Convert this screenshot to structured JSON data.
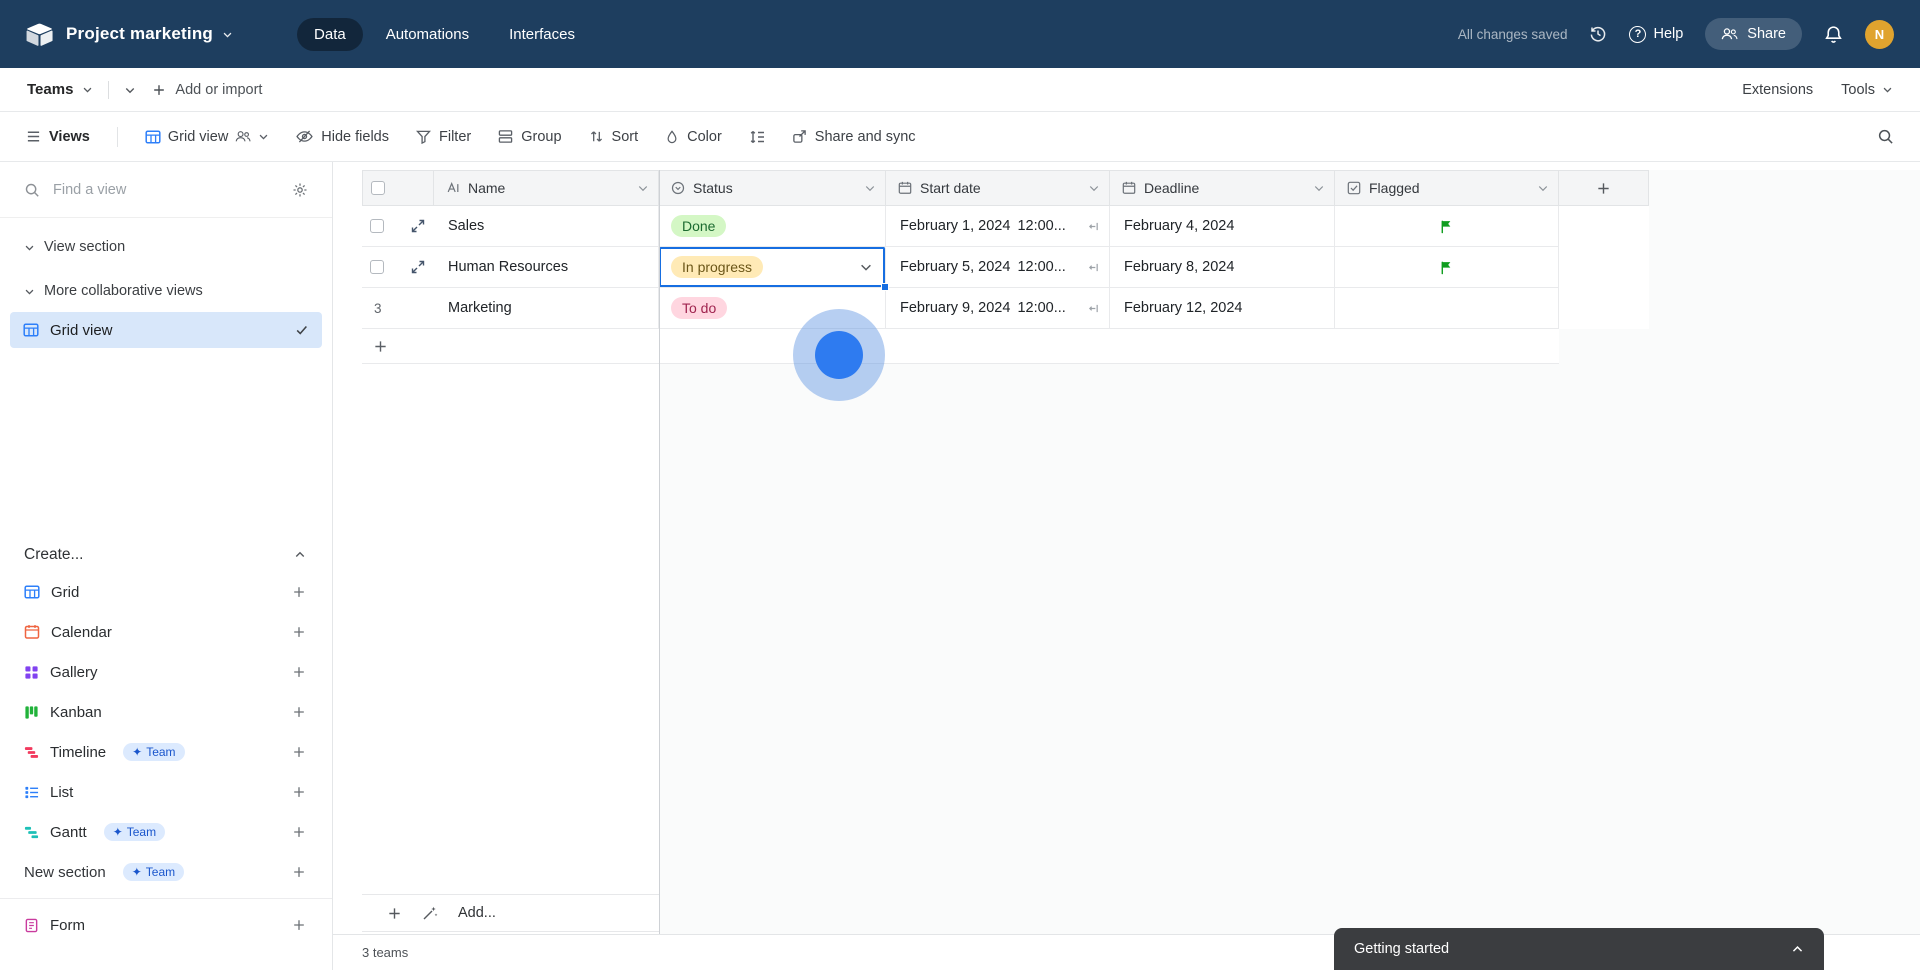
{
  "topbar": {
    "base_name": "Project marketing",
    "tabs": [
      {
        "label": "Data"
      },
      {
        "label": "Automations"
      },
      {
        "label": "Interfaces"
      }
    ],
    "saved_status": "All changes saved",
    "help_label": "Help",
    "share_label": "Share",
    "avatar_initial": "N"
  },
  "tablebar": {
    "table_name": "Teams",
    "add_or_import": "Add or import",
    "extensions": "Extensions",
    "tools": "Tools"
  },
  "toolbar": {
    "views": "Views",
    "view_name": "Grid view",
    "hide_fields": "Hide fields",
    "filter": "Filter",
    "group": "Group",
    "sort": "Sort",
    "color": "Color",
    "share_sync": "Share and sync"
  },
  "sidebar": {
    "search_placeholder": "Find a view",
    "section_views": "View section",
    "section_collab": "More collaborative views",
    "selected_view": "Grid view",
    "create_header": "Create...",
    "items": [
      {
        "label": "Grid"
      },
      {
        "label": "Calendar"
      },
      {
        "label": "Gallery"
      },
      {
        "label": "Kanban"
      },
      {
        "label": "Timeline",
        "badge": "Team"
      },
      {
        "label": "List"
      },
      {
        "label": "Gantt",
        "badge": "Team"
      },
      {
        "label": "New section",
        "badge": "Team"
      },
      {
        "label": "Form"
      }
    ]
  },
  "grid": {
    "columns": {
      "name": "Name",
      "status": "Status",
      "start": "Start date",
      "deadline": "Deadline",
      "flagged": "Flagged"
    },
    "rows": [
      {
        "name": "Sales",
        "status": "Done",
        "start_date": "February 1, 2024",
        "start_time": "12:00...",
        "deadline": "February 4, 2024"
      },
      {
        "name": "Human Resources",
        "status": "In progress",
        "start_date": "February 5, 2024",
        "start_time": "12:00...",
        "deadline": "February 8, 2024"
      },
      {
        "row_number": "3",
        "name": "Marketing",
        "status": "To do",
        "start_date": "February 9, 2024",
        "start_time": "12:00...",
        "deadline": "February 12, 2024"
      }
    ],
    "add_row_label": "Add...",
    "record_count": "3 teams"
  },
  "toast": {
    "title": "Getting started"
  },
  "colors": {
    "accent": "#166ee1",
    "topbar_bg": "#1e3e5f",
    "status_done": {
      "bg": "#d4f7c5",
      "text": "#1c6b30"
    },
    "status_in_progress": {
      "bg": "#ffeab6",
      "text": "#6b5618"
    },
    "status_to_do": {
      "bg": "#ffd6e0",
      "text": "#a0244f"
    },
    "flag_green": "#0f9d1f",
    "selected_view_bg": "#d8e7fa",
    "team_badge": {
      "bg": "#dceafe",
      "text": "#1a56cc"
    }
  }
}
